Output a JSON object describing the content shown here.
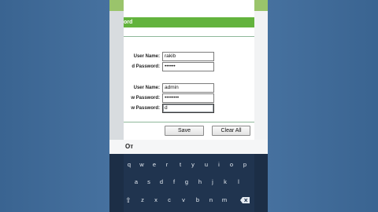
{
  "screen": {
    "title_partial": "ord"
  },
  "form": {
    "old_user_label": "User Name:",
    "old_user_value": "rakib",
    "old_pass_label": "d Password:",
    "old_pass_value": "••••••",
    "new_user_label": "User Name:",
    "new_user_value": "admin",
    "new_pass_label": "w Password:",
    "new_pass_value": "••••••••",
    "confirm_label": "w Password:",
    "confirm_value": "d"
  },
  "buttons": {
    "save": "Save",
    "clear": "Clear All"
  },
  "keyboard": {
    "row1": [
      "q",
      "w",
      "e",
      "r",
      "t",
      "y",
      "u",
      "i",
      "o",
      "p"
    ],
    "row2": [
      "a",
      "s",
      "d",
      "f",
      "g",
      "h",
      "j",
      "k",
      "l"
    ],
    "row3": [
      "z",
      "x",
      "c",
      "v",
      "b",
      "n",
      "m"
    ],
    "key_icon": "Oᴛ"
  },
  "colors": {
    "title_green": "#63b33d",
    "keyboard_bg": "#20344f",
    "backdrop": "#3f6b99"
  },
  "icons": [
    "key-icon",
    "shift-icon",
    "backspace-icon"
  ]
}
